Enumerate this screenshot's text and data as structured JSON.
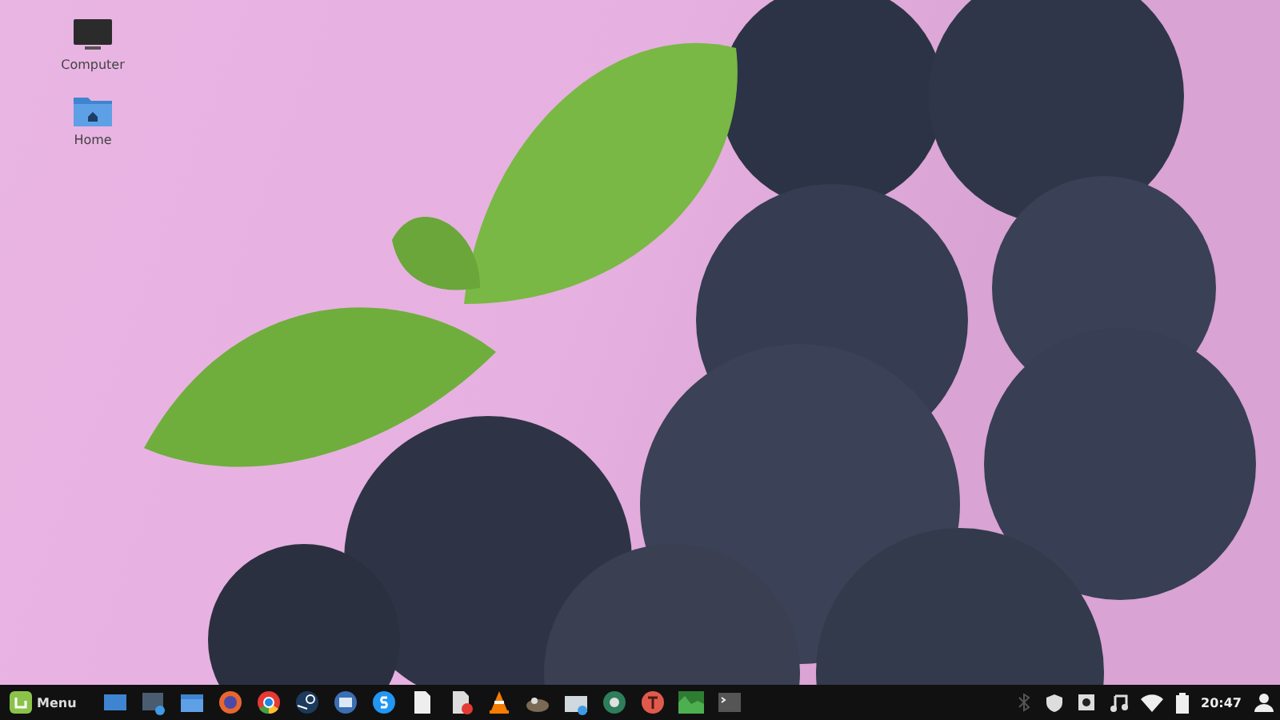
{
  "desktop_icons": [
    {
      "label": "Computer",
      "kind": "computer"
    },
    {
      "label": "Home",
      "kind": "folder"
    }
  ],
  "taskbar": {
    "menu_label": "Menu",
    "clock": "20:47"
  }
}
